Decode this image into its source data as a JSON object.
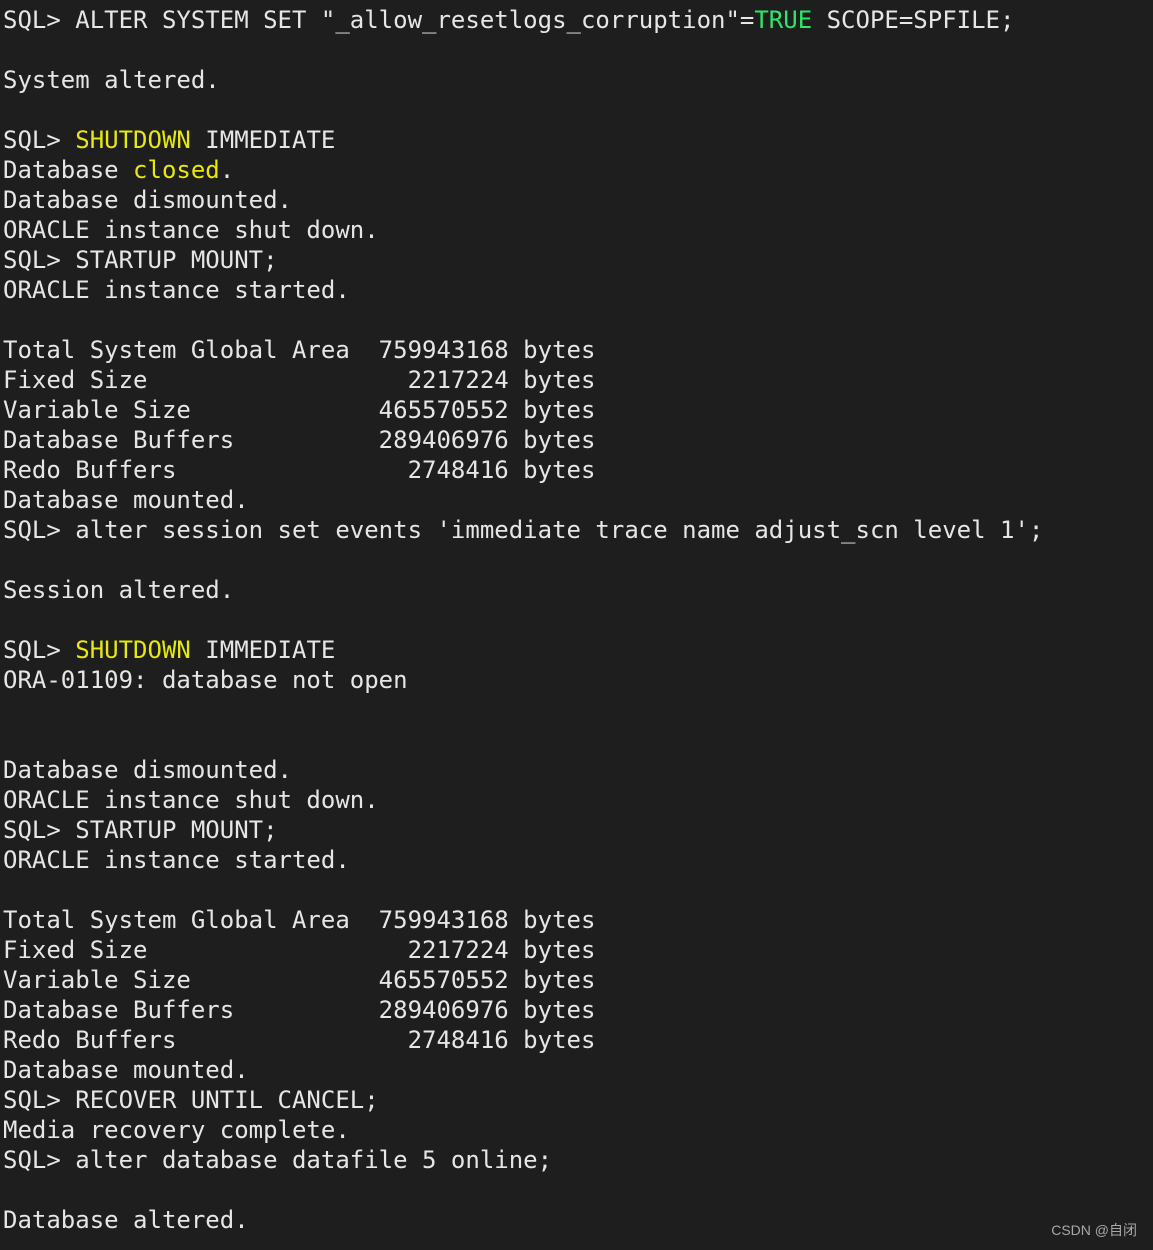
{
  "theme": {
    "background": "#1e1e1e",
    "text": "#e6e6e6",
    "keyword_yellow": "#e8e80a",
    "keyword_green": "#2ee66b"
  },
  "terminal": {
    "lines": [
      [
        {
          "t": "SQL> ALTER SYSTEM SET \"_allow_resetlogs_corruption\"="
        },
        {
          "t": "TRUE",
          "c": "green"
        },
        {
          "t": " SCOPE=SPFILE;"
        }
      ],
      [],
      [
        {
          "t": "System altered."
        }
      ],
      [],
      [
        {
          "t": "SQL> "
        },
        {
          "t": "SHUTDOWN",
          "c": "yellow"
        },
        {
          "t": " IMMEDIATE"
        }
      ],
      [
        {
          "t": "Database "
        },
        {
          "t": "closed",
          "c": "yellow"
        },
        {
          "t": "."
        }
      ],
      [
        {
          "t": "Database dismounted."
        }
      ],
      [
        {
          "t": "ORACLE instance shut down."
        }
      ],
      [
        {
          "t": "SQL> STARTUP MOUNT;"
        }
      ],
      [
        {
          "t": "ORACLE instance started."
        }
      ],
      [],
      [
        {
          "t": "Total System Global Area  759943168 bytes"
        }
      ],
      [
        {
          "t": "Fixed Size                  2217224 bytes"
        }
      ],
      [
        {
          "t": "Variable Size             465570552 bytes"
        }
      ],
      [
        {
          "t": "Database Buffers          289406976 bytes"
        }
      ],
      [
        {
          "t": "Redo Buffers                2748416 bytes"
        }
      ],
      [
        {
          "t": "Database mounted."
        }
      ],
      [
        {
          "t": "SQL> alter session set events 'immediate trace name adjust_scn level 1';"
        }
      ],
      [],
      [
        {
          "t": "Session altered."
        }
      ],
      [],
      [
        {
          "t": "SQL> "
        },
        {
          "t": "SHUTDOWN",
          "c": "yellow"
        },
        {
          "t": " IMMEDIATE"
        }
      ],
      [
        {
          "t": "ORA-01109: database not open"
        }
      ],
      [],
      [],
      [
        {
          "t": "Database dismounted."
        }
      ],
      [
        {
          "t": "ORACLE instance shut down."
        }
      ],
      [
        {
          "t": "SQL> STARTUP MOUNT;"
        }
      ],
      [
        {
          "t": "ORACLE instance started."
        }
      ],
      [],
      [
        {
          "t": "Total System Global Area  759943168 bytes"
        }
      ],
      [
        {
          "t": "Fixed Size                  2217224 bytes"
        }
      ],
      [
        {
          "t": "Variable Size             465570552 bytes"
        }
      ],
      [
        {
          "t": "Database Buffers          289406976 bytes"
        }
      ],
      [
        {
          "t": "Redo Buffers                2748416 bytes"
        }
      ],
      [
        {
          "t": "Database mounted."
        }
      ],
      [
        {
          "t": "SQL> RECOVER UNTIL CANCEL;"
        }
      ],
      [
        {
          "t": "Media recovery complete."
        }
      ],
      [
        {
          "t": "SQL> alter database datafile 5 online;"
        }
      ],
      [],
      [
        {
          "t": "Database altered."
        }
      ]
    ]
  },
  "watermark": {
    "text": "CSDN @自闭"
  }
}
